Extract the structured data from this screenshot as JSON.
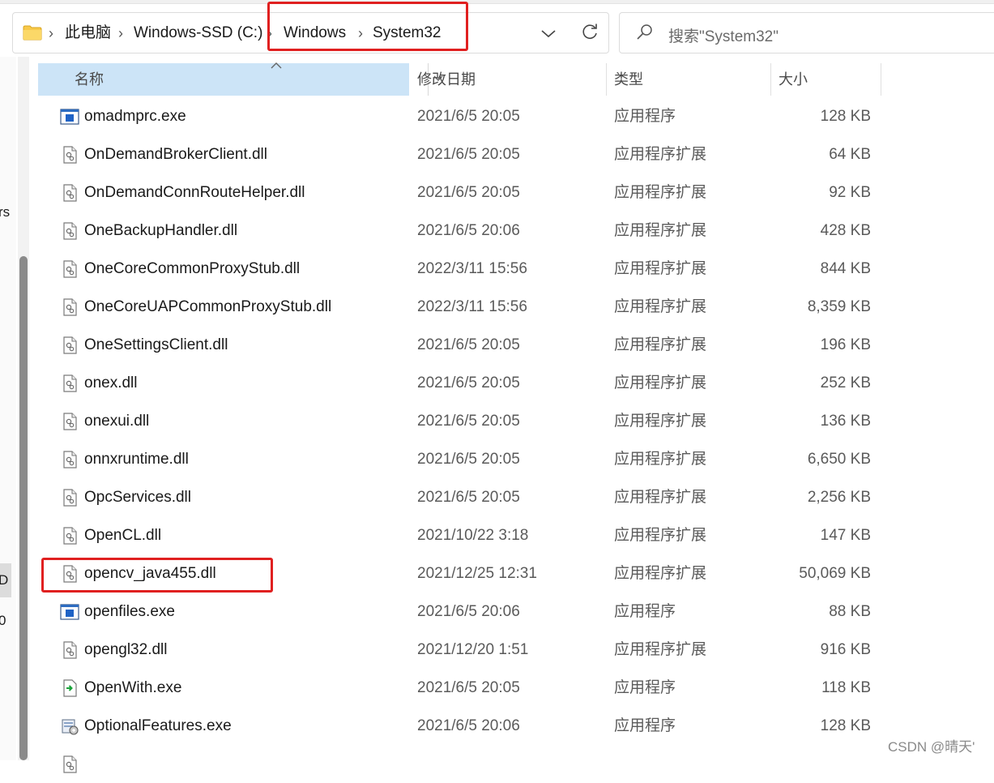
{
  "breadcrumb": {
    "items": [
      "此电脑",
      "Windows-SSD (C:)",
      "Windows",
      "System32"
    ]
  },
  "search": {
    "placeholder": "搜索\"System32\""
  },
  "left_pane": {
    "fragments": [
      "rs",
      "D",
      "0"
    ]
  },
  "columns": {
    "name": "名称",
    "date": "修改日期",
    "type": "类型",
    "size": "大小"
  },
  "files": [
    {
      "name": "omadmprc.exe",
      "date": "2021/6/5 20:05",
      "type": "应用程序",
      "size": "128 KB",
      "icon": "exe-icon"
    },
    {
      "name": "OnDemandBrokerClient.dll",
      "date": "2021/6/5 20:05",
      "type": "应用程序扩展",
      "size": "64 KB",
      "icon": "dll-icon"
    },
    {
      "name": "OnDemandConnRouteHelper.dll",
      "date": "2021/6/5 20:05",
      "type": "应用程序扩展",
      "size": "92 KB",
      "icon": "dll-icon"
    },
    {
      "name": "OneBackupHandler.dll",
      "date": "2021/6/5 20:06",
      "type": "应用程序扩展",
      "size": "428 KB",
      "icon": "dll-icon"
    },
    {
      "name": "OneCoreCommonProxyStub.dll",
      "date": "2022/3/11 15:56",
      "type": "应用程序扩展",
      "size": "844 KB",
      "icon": "dll-icon"
    },
    {
      "name": "OneCoreUAPCommonProxyStub.dll",
      "date": "2022/3/11 15:56",
      "type": "应用程序扩展",
      "size": "8,359 KB",
      "icon": "dll-icon"
    },
    {
      "name": "OneSettingsClient.dll",
      "date": "2021/6/5 20:05",
      "type": "应用程序扩展",
      "size": "196 KB",
      "icon": "dll-icon"
    },
    {
      "name": "onex.dll",
      "date": "2021/6/5 20:05",
      "type": "应用程序扩展",
      "size": "252 KB",
      "icon": "dll-icon"
    },
    {
      "name": "onexui.dll",
      "date": "2021/6/5 20:05",
      "type": "应用程序扩展",
      "size": "136 KB",
      "icon": "dll-icon"
    },
    {
      "name": "onnxruntime.dll",
      "date": "2021/6/5 20:05",
      "type": "应用程序扩展",
      "size": "6,650 KB",
      "icon": "dll-icon"
    },
    {
      "name": "OpcServices.dll",
      "date": "2021/6/5 20:05",
      "type": "应用程序扩展",
      "size": "2,256 KB",
      "icon": "dll-icon"
    },
    {
      "name": "OpenCL.dll",
      "date": "2021/10/22 3:18",
      "type": "应用程序扩展",
      "size": "147 KB",
      "icon": "dll-icon"
    },
    {
      "name": "opencv_java455.dll",
      "date": "2021/12/25 12:31",
      "type": "应用程序扩展",
      "size": "50,069 KB",
      "icon": "dll-icon"
    },
    {
      "name": "openfiles.exe",
      "date": "2021/6/5 20:06",
      "type": "应用程序",
      "size": "88 KB",
      "icon": "exe-icon"
    },
    {
      "name": "opengl32.dll",
      "date": "2021/12/20 1:51",
      "type": "应用程序扩展",
      "size": "916 KB",
      "icon": "dll-icon"
    },
    {
      "name": "OpenWith.exe",
      "date": "2021/6/5 20:05",
      "type": "应用程序",
      "size": "118 KB",
      "icon": "openwith-icon"
    },
    {
      "name": "OptionalFeatures.exe",
      "date": "2021/6/5 20:06",
      "type": "应用程序",
      "size": "128 KB",
      "icon": "features-icon"
    },
    {
      "name": "",
      "date": "",
      "type": "",
      "size": "",
      "icon": "dll-icon"
    }
  ],
  "watermark": "CSDN @晴天'",
  "colors": {
    "highlight": "#e02020",
    "header_selected": "#cce4f7"
  }
}
